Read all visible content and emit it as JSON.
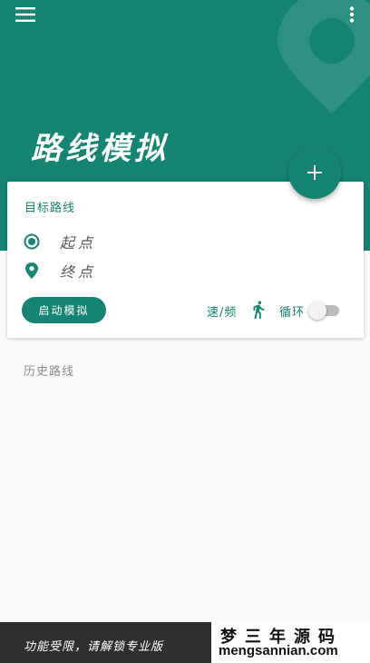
{
  "header": {
    "title": "路线模拟",
    "menu_icon": "hamburger-menu-icon",
    "more_icon": "more-vert-icon"
  },
  "fab": {
    "icon": "plus-icon"
  },
  "card": {
    "title": "目标路线",
    "start_point": "起点",
    "end_point": "终点",
    "start_button": "启动模拟",
    "speed_label": "速/频",
    "loop_label": "循环",
    "loop_enabled": false
  },
  "history": {
    "title": "历史路线"
  },
  "bottom": {
    "notice": "功能受限，请解锁专业版",
    "watermark_cn": "梦三年源码",
    "watermark_en": "mengsannian.com"
  },
  "colors": {
    "primary": "#168473",
    "background": "#fafafa",
    "bottom_bar": "#2f2f2f"
  }
}
